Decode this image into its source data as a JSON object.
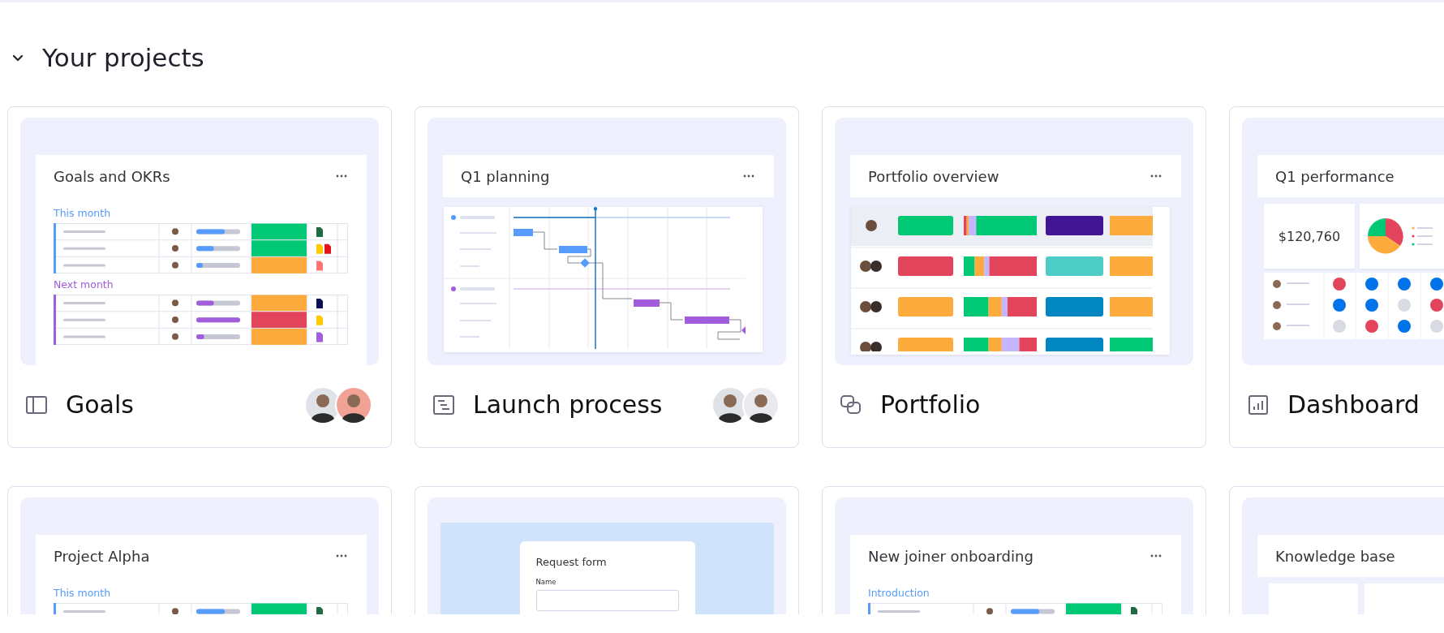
{
  "section": {
    "title": "Your projects",
    "expanded": true
  },
  "projects": [
    {
      "kind": "table",
      "name": "Goals",
      "shared": true,
      "preview_title": "Goals and OKRs",
      "groups": [
        {
          "label": "This month",
          "color": "#579bfc"
        },
        {
          "label": "Next month",
          "color": "#a25ddc"
        }
      ]
    },
    {
      "kind": "gantt",
      "name": "Launch process",
      "shared": true,
      "preview_title": "Q1 planning"
    },
    {
      "kind": "portfolio",
      "name": "Portfolio",
      "shared": false,
      "preview_title": "Portfolio overview"
    },
    {
      "kind": "dashboard",
      "name": "Dashboard",
      "preview_title": "Q1 performance",
      "kpi": "$120,760"
    },
    {
      "kind": "table",
      "preview_title": "Project Alpha",
      "groups": [
        {
          "label": "This month",
          "color": "#579bfc"
        }
      ]
    },
    {
      "kind": "form",
      "form_title": "Request form",
      "field_label": "Name"
    },
    {
      "kind": "table",
      "preview_title": "New joiner onboarding",
      "groups": [
        {
          "label": "Introduction",
          "color": "#579bfc"
        }
      ]
    },
    {
      "kind": "docs",
      "preview_title": "Knowledge base"
    }
  ]
}
